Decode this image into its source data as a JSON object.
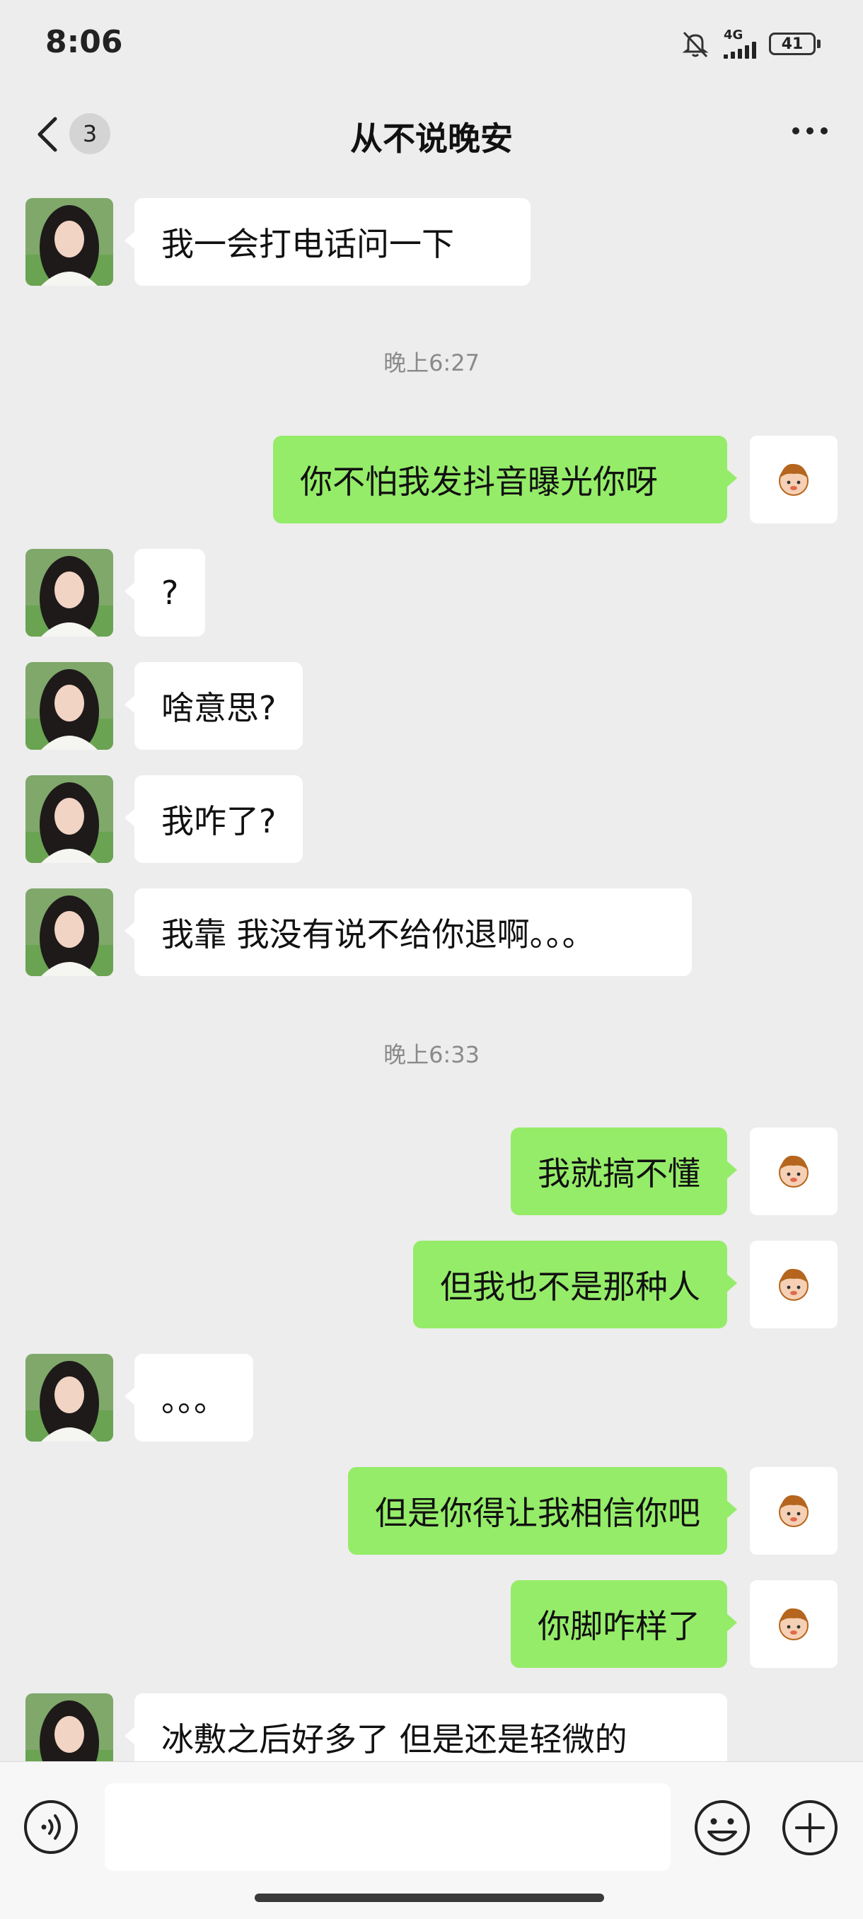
{
  "status_bar": {
    "time": "8:06",
    "network": "4G",
    "battery": "41"
  },
  "header": {
    "unread_count": "3",
    "title": "从不说晚安"
  },
  "messages": [
    {
      "side": "left",
      "text": "我一会打电话问一下"
    },
    {
      "type": "time",
      "text": "晚上6:27"
    },
    {
      "side": "right",
      "text": "你不怕我发抖音曝光你呀"
    },
    {
      "side": "left",
      "text": "?"
    },
    {
      "side": "left",
      "text": "啥意思?"
    },
    {
      "side": "left",
      "text": "我咋了?"
    },
    {
      "side": "left",
      "text": "我靠 我没有说不给你退啊。。。"
    },
    {
      "type": "time",
      "text": "晚上6:33"
    },
    {
      "side": "right",
      "text": "我就搞不懂"
    },
    {
      "side": "right",
      "text": "但我也不是那种人"
    },
    {
      "side": "left",
      "text": "。。。"
    },
    {
      "side": "right",
      "text": "但是你得让我相信你吧"
    },
    {
      "side": "right",
      "text": "你脚咋样了"
    },
    {
      "side": "left",
      "text": "冰敷之后好多了 但是还是轻微的"
    }
  ],
  "input": {
    "placeholder": ""
  }
}
